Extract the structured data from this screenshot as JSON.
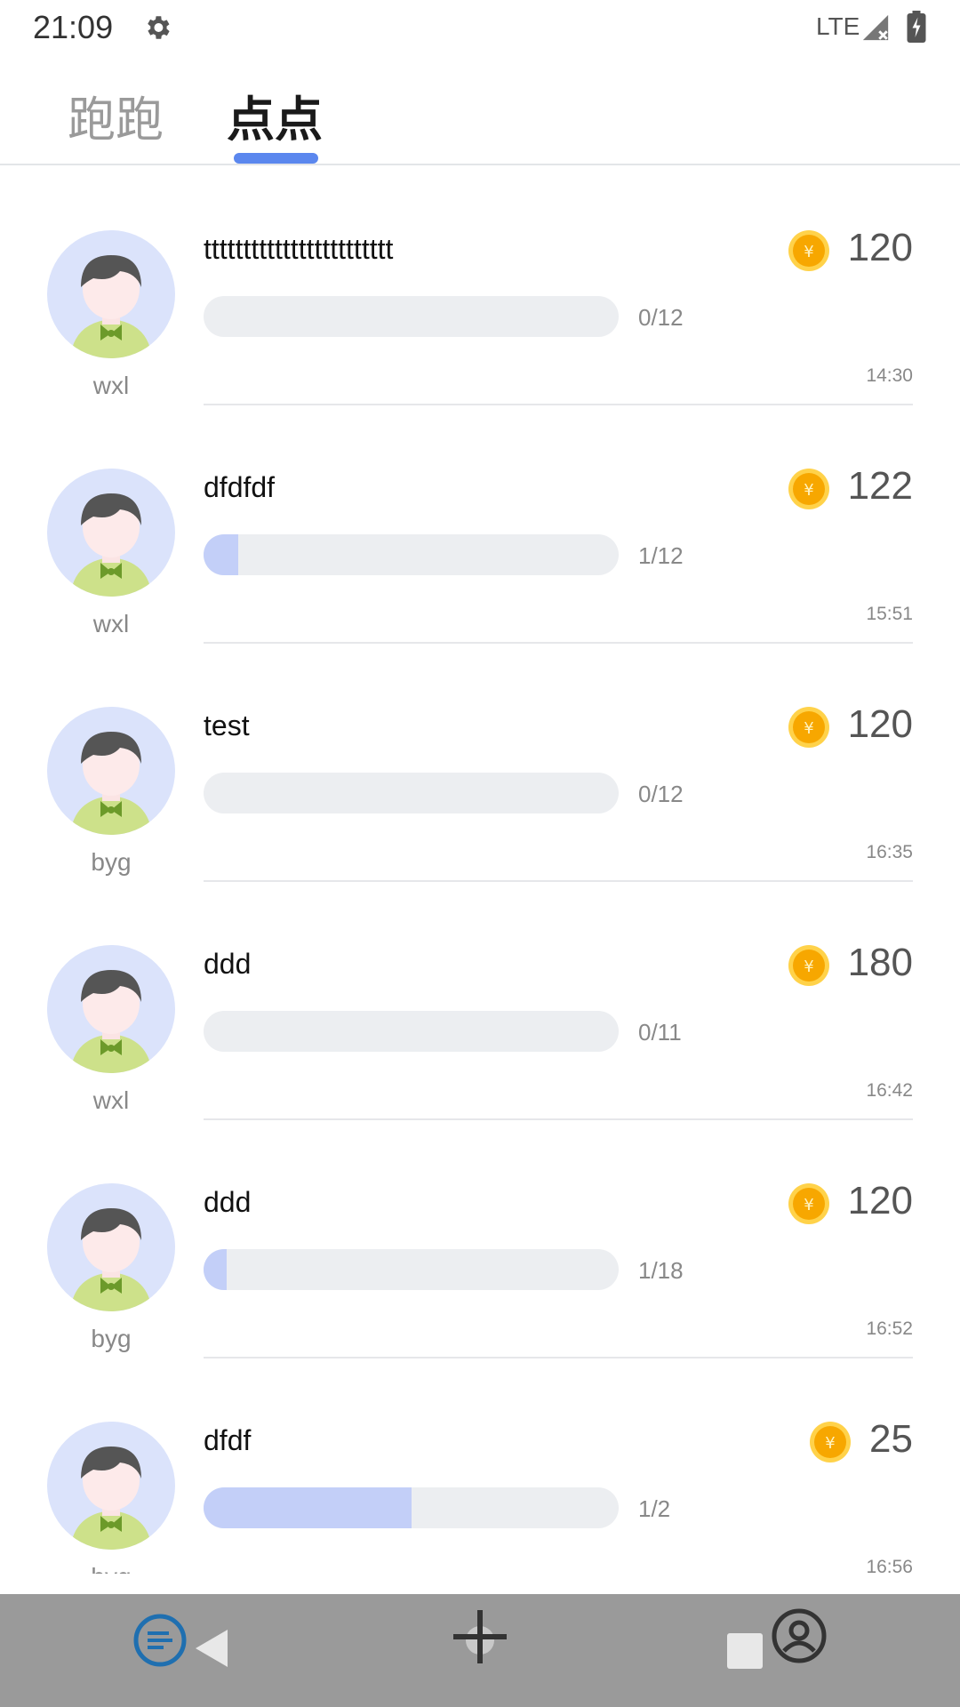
{
  "status": {
    "time": "21:09",
    "network": "LTE"
  },
  "tabs": [
    {
      "label": "跑跑",
      "active": false
    },
    {
      "label": "点点",
      "active": true
    }
  ],
  "colors": {
    "accent": "#5b87ee",
    "progress_fill": "#c3cff8",
    "coin": "#f7a700"
  },
  "items": [
    {
      "user": "wxl",
      "title": "tttttttttttttttttttttttt",
      "reward": "120",
      "progress_text": "0/12",
      "progress": 0.0,
      "time": "14:30"
    },
    {
      "user": "wxl",
      "title": "dfdfdf",
      "reward": "122",
      "progress_text": "1/12",
      "progress": 0.083,
      "time": "15:51"
    },
    {
      "user": "byg",
      "title": "test",
      "reward": "120",
      "progress_text": "0/12",
      "progress": 0.0,
      "time": "16:35"
    },
    {
      "user": "wxl",
      "title": "ddd",
      "reward": "180",
      "progress_text": "0/11",
      "progress": 0.0,
      "time": "16:42"
    },
    {
      "user": "byg",
      "title": "ddd",
      "reward": "120",
      "progress_text": "1/18",
      "progress": 0.055,
      "time": "16:52"
    },
    {
      "user": "byg",
      "title": "dfdf",
      "reward": "25",
      "progress_text": "1/2",
      "progress": 0.5,
      "time": "16:56"
    }
  ],
  "icons": {
    "settings": "gear-icon",
    "signal": "signal-icon",
    "battery": "battery-icon",
    "coin": "coin-icon",
    "avatar": "avatar-icon",
    "nav_left": "list-icon",
    "nav_back": "back-icon",
    "nav_center": "crosshair-icon",
    "nav_recents": "square-icon",
    "nav_profile": "profile-icon"
  }
}
